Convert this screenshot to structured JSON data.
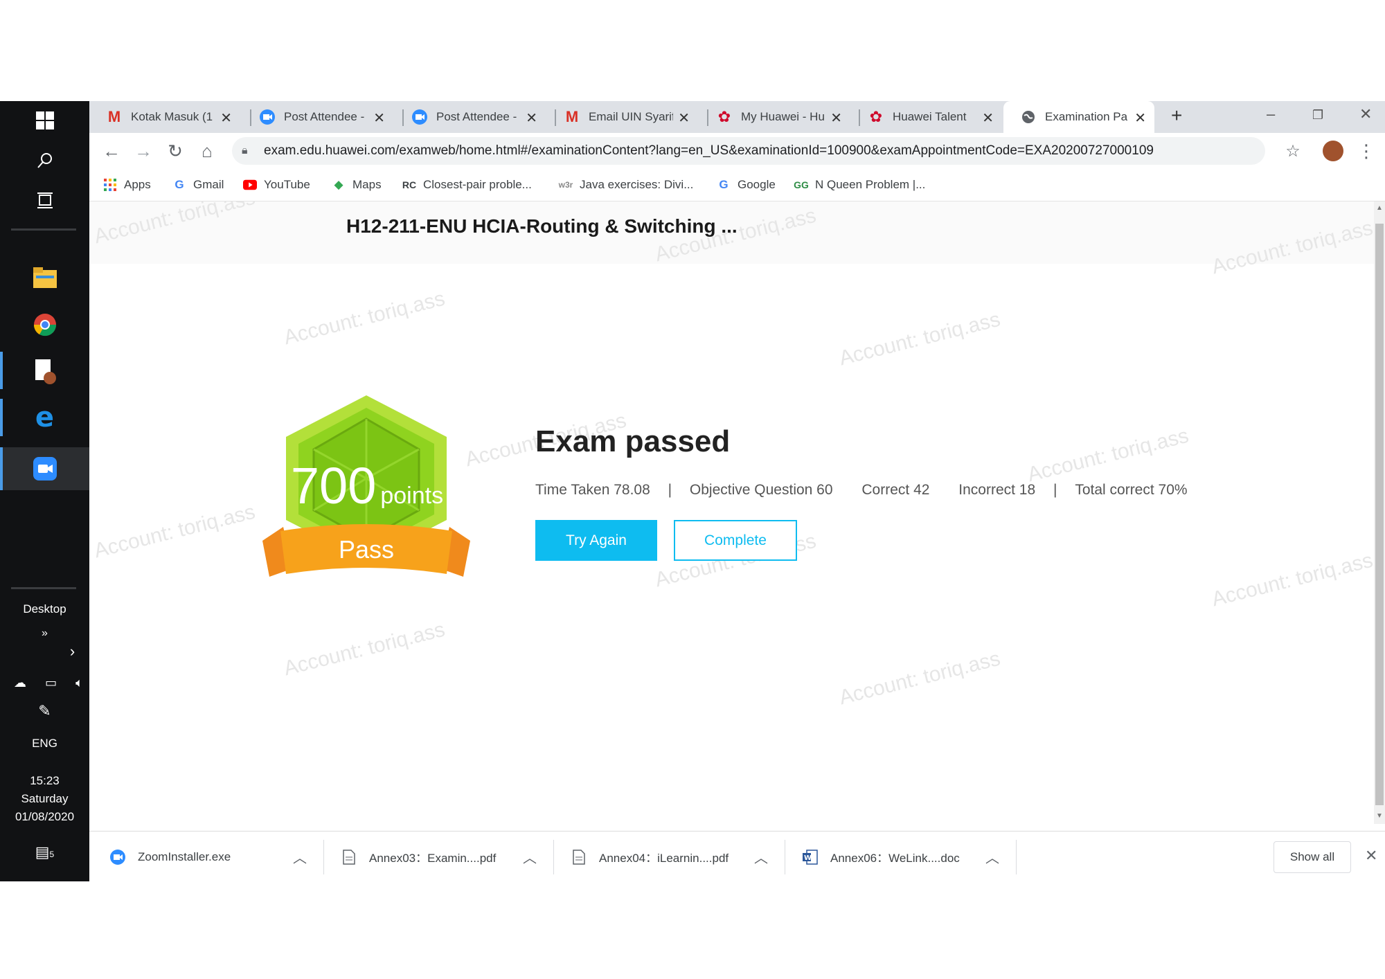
{
  "taskbar": {
    "icons": [
      "windows-logo-icon",
      "search-icon",
      "task-view-icon",
      "file-explorer-icon",
      "chrome-icon",
      "document-icon",
      "edge-icon",
      "zoom-icon"
    ],
    "desktop_label": "Desktop",
    "lang": "ENG",
    "time": "15:23",
    "day": "Saturday",
    "date": "01/08/2020",
    "notification_count": "5"
  },
  "tabs": [
    {
      "title": "Kotak Masuk (1",
      "icon": "gmail-icon"
    },
    {
      "title": "Post Attendee -",
      "icon": "zoom-icon"
    },
    {
      "title": "Post Attendee -",
      "icon": "zoom-icon"
    },
    {
      "title": "Email UIN Syarif",
      "icon": "gmail-icon"
    },
    {
      "title": "My Huawei - Hu",
      "icon": "huawei-icon"
    },
    {
      "title": "Huawei Talent",
      "icon": "huawei-icon"
    },
    {
      "title": "Examination Pa",
      "icon": "globe-icon",
      "active": true
    }
  ],
  "toolbar": {
    "url": "exam.edu.huawei.com/examweb/home.html#/examinationContent?lang=en_US&examinationId=100900&examAppointmentCode=EXA20200727000109"
  },
  "bookmarks": [
    {
      "label": "Apps",
      "icon": "apps-grid-icon"
    },
    {
      "label": "Gmail",
      "icon": "google-icon"
    },
    {
      "label": "YouTube",
      "icon": "youtube-icon"
    },
    {
      "label": "Maps",
      "icon": "maps-icon"
    },
    {
      "label": "Closest-pair proble...",
      "icon": "rc-icon"
    },
    {
      "label": "Java exercises: Divi...",
      "icon": "w3r-icon"
    },
    {
      "label": "Google",
      "icon": "google-icon"
    },
    {
      "label": "N Queen Problem |...",
      "icon": "gfg-icon"
    }
  ],
  "page": {
    "exam_title": "H12-211-ENU HCIA-Routing & Switching ...",
    "watermark": "Account: toriq.ass",
    "badge": {
      "score": "700",
      "unit": "points",
      "result": "Pass"
    },
    "result_title": "Exam passed",
    "stats": {
      "time_taken": "Time Taken 78.08",
      "sep": "|",
      "objective": "Objective Question 60",
      "correct": "Correct 42",
      "incorrect": "Incorrect 18",
      "total": "Total correct 70%"
    },
    "try_again": "Try Again",
    "complete": "Complete"
  },
  "downloads": {
    "items": [
      {
        "name": "ZoomInstaller.exe",
        "icon": "zoom-icon"
      },
      {
        "name": "Annex03：Examin....pdf",
        "icon": "file-icon"
      },
      {
        "name": "Annex04：iLearnin....pdf",
        "icon": "file-icon"
      },
      {
        "name": "Annex06：WeLink....doc",
        "icon": "word-icon"
      }
    ],
    "show_all": "Show all"
  },
  "colors": {
    "accent": "#0ebcf0",
    "badge_green": "#8fd31f",
    "badge_orange": "#f7a21b",
    "taskbar": "#111214"
  }
}
